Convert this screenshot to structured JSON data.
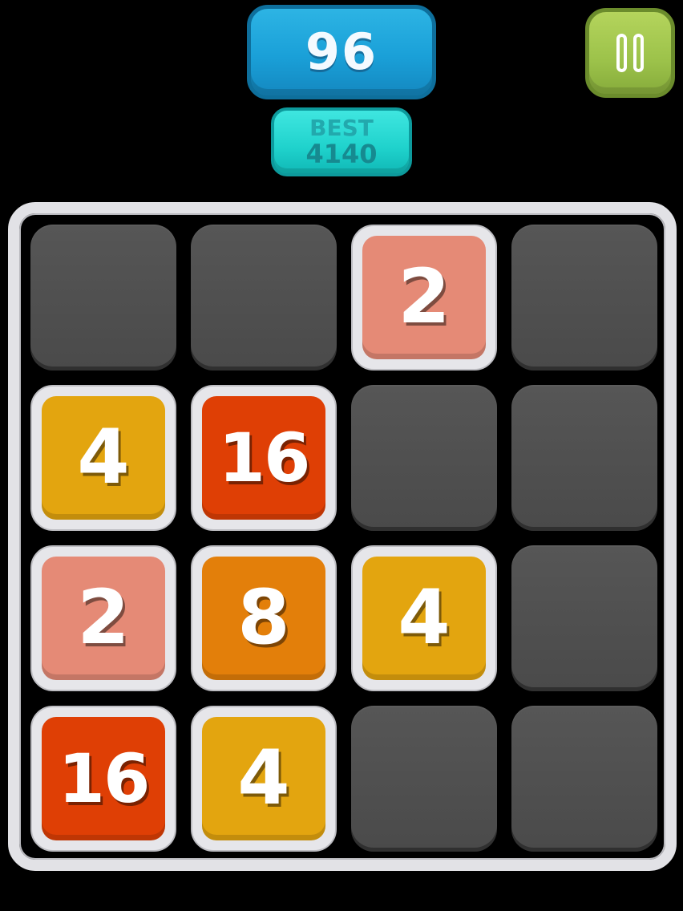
{
  "score": {
    "value": "96"
  },
  "best": {
    "label": "BEST",
    "value": "4140"
  },
  "pause": {
    "icon": "pause-icon"
  },
  "colors": {
    "tile_2": "#e58a76",
    "tile_4": "#e3a50f",
    "tile_8": "#e37f0a",
    "tile_16": "#df3f05",
    "empty": "#4d4d4d",
    "score_bg": "#1ea4da",
    "best_bg": "#24d8d2",
    "pause_bg": "#a3c650"
  },
  "board": {
    "rows": [
      [
        null,
        null,
        "2",
        null
      ],
      [
        "4",
        "16",
        null,
        null
      ],
      [
        "2",
        "8",
        "4",
        null
      ],
      [
        "16",
        "4",
        null,
        null
      ]
    ]
  }
}
